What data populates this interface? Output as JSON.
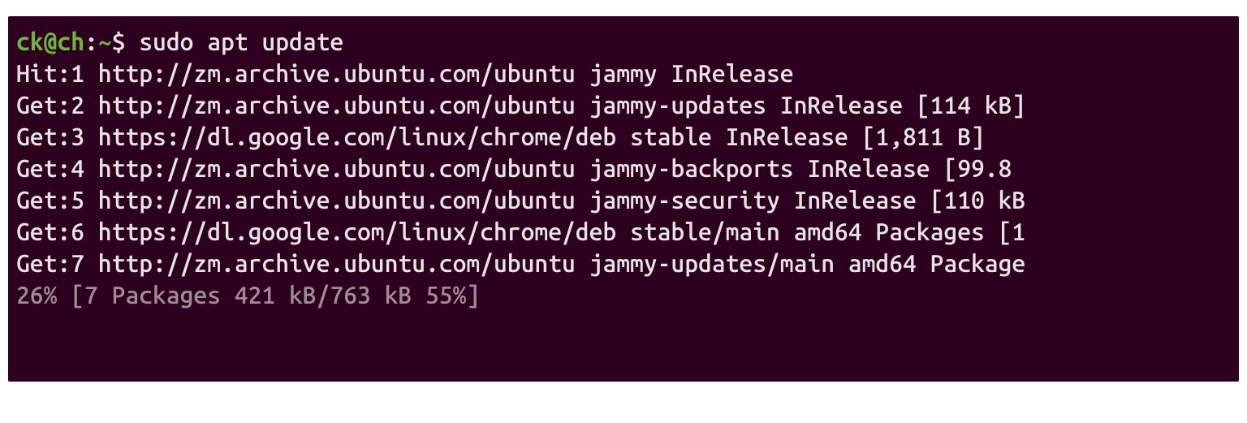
{
  "prompt": {
    "user_host": "ck@ch",
    "separator": ":",
    "path": "~",
    "symbol": "$ ",
    "command": "sudo apt update"
  },
  "output_lines": [
    "Hit:1 http://zm.archive.ubuntu.com/ubuntu jammy InRelease",
    "Get:2 http://zm.archive.ubuntu.com/ubuntu jammy-updates InRelease [114 kB]",
    "Get:3 https://dl.google.com/linux/chrome/deb stable InRelease [1,811 B]",
    "Get:4 http://zm.archive.ubuntu.com/ubuntu jammy-backports InRelease [99.8 ",
    "Get:5 http://zm.archive.ubuntu.com/ubuntu jammy-security InRelease [110 kB",
    "Get:6 https://dl.google.com/linux/chrome/deb stable/main amd64 Packages [1",
    "Get:7 http://zm.archive.ubuntu.com/ubuntu jammy-updates/main amd64 Package"
  ],
  "progress_line": "26% [7 Packages 421 kB/763 kB 55%]"
}
